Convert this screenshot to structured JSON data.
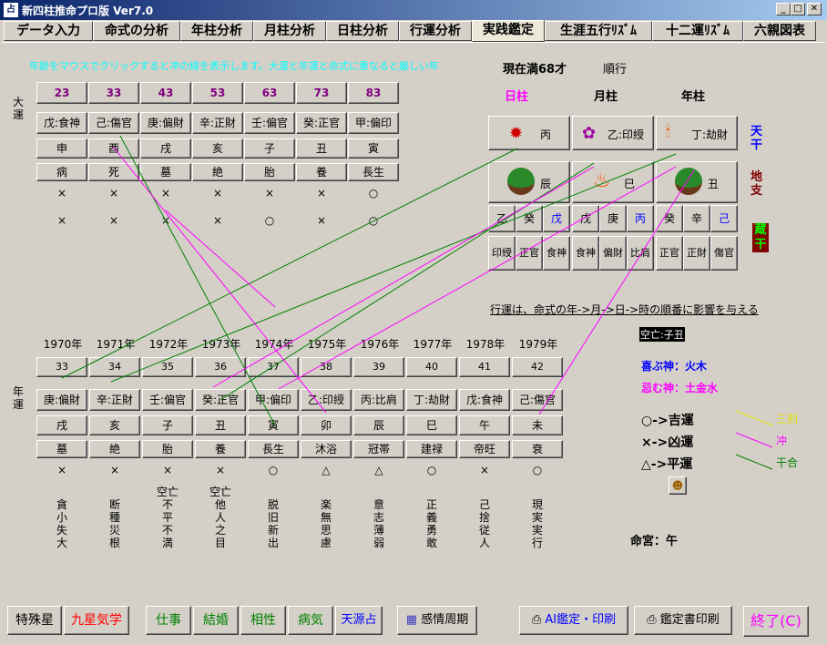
{
  "window": {
    "title": "新四柱推命プロ版 Ver7.0",
    "icon_name": "app-icon",
    "minimize_label": "_",
    "maximize_label": "□",
    "close_label": "✕"
  },
  "tabs": [
    {
      "label": "データ入力"
    },
    {
      "label": "命式の分析"
    },
    {
      "label": "年柱分析"
    },
    {
      "label": "月柱分析"
    },
    {
      "label": "日柱分析"
    },
    {
      "label": "行運分析"
    },
    {
      "label": "実践鑑定"
    },
    {
      "label": "生涯五行ﾘｽﾞﾑ"
    },
    {
      "label": "十二運ﾘｽﾞﾑ"
    },
    {
      "label": "六親図表"
    }
  ],
  "info": {
    "marquee": "年齢をマウスでクリックすると冲の線を表示します。大運と年運と命式に重なると厳しい年",
    "current_age": "現在満68才",
    "direction": "順行"
  },
  "daiun": {
    "side_label": "大運",
    "ages": [
      "23",
      "33",
      "43",
      "53",
      "63",
      "73",
      "83"
    ],
    "stems": [
      "戊:食神",
      "己:傷官",
      "庚:偏財",
      "辛:正財",
      "壬:偏官",
      "癸:正官",
      "甲:偏印"
    ],
    "branches": [
      "申",
      "酉",
      "戌",
      "亥",
      "子",
      "丑",
      "寅"
    ],
    "twelve": [
      "病",
      "死",
      "墓",
      "絶",
      "胎",
      "養",
      "長生"
    ],
    "mark1": [
      "×",
      "×",
      "×",
      "×",
      "×",
      "×",
      "○"
    ],
    "mark2": [
      "×",
      "×",
      "×",
      "×",
      "○",
      "×",
      "○"
    ]
  },
  "meishiki": {
    "col_day": "日柱",
    "col_month": "月柱",
    "col_year": "年柱",
    "stems": [
      "丙",
      "乙:印綬",
      "丁:劫財"
    ],
    "stem_icons": [
      "sun-icon",
      "flower-icon",
      "candle-icon"
    ],
    "branches": [
      "辰",
      "巳",
      "丑"
    ],
    "branch_icons": [
      "tree-icon",
      "fire-icon",
      "tree-icon"
    ],
    "hidden_stems": [
      [
        "乙",
        "癸",
        "戊"
      ],
      [
        "戊",
        "庚",
        "丙"
      ],
      [
        "癸",
        "辛",
        "己"
      ]
    ],
    "hidden_colors": [
      [
        "#000000",
        "#000000",
        "#0000ff"
      ],
      [
        "#000000",
        "#000000",
        "#0000ff"
      ],
      [
        "#000000",
        "#000000",
        "#0000ff"
      ]
    ],
    "hidden_stars": [
      [
        "印綬",
        "正官",
        "食神"
      ],
      [
        "食神",
        "偏財",
        "比肩"
      ],
      [
        "正官",
        "正財",
        "傷官"
      ]
    ],
    "side_tenkan": "天干",
    "side_chishi": "地支",
    "side_zoukan": "蔵干"
  },
  "note": {
    "flow": "行運は、命式の年->月->日->時の順番に影響を与える",
    "kubo": "空亡:子丑",
    "kishin": "喜ぶ神：火木",
    "kijin": "忌む神：土金水"
  },
  "legend": {
    "good": "○->吉運",
    "bad": "×->凶運",
    "flat": "△->平運",
    "sankei": "三刑",
    "chuu": "冲",
    "kango": "干合",
    "colors": {
      "sankei": "#e0e000",
      "chuu": "#ff00ff",
      "kango": "#008000"
    }
  },
  "nenun": {
    "side_label": "年運",
    "years": [
      "1970年",
      "1971年",
      "1972年",
      "1973年",
      "1974年",
      "1975年",
      "1976年",
      "1977年",
      "1978年",
      "1979年"
    ],
    "ages": [
      "33",
      "34",
      "35",
      "36",
      "37",
      "38",
      "39",
      "40",
      "41",
      "42"
    ],
    "stems": [
      "庚:偏財",
      "辛:正財",
      "壬:偏官",
      "癸:正官",
      "甲:偏印",
      "乙:印綬",
      "丙:比肩",
      "丁:劫財",
      "戊:食神",
      "己:傷官"
    ],
    "branches": [
      "戌",
      "亥",
      "子",
      "丑",
      "寅",
      "卯",
      "辰",
      "巳",
      "午",
      "未"
    ],
    "twelve": [
      "墓",
      "絶",
      "胎",
      "養",
      "長生",
      "沐浴",
      "冠帯",
      "建禄",
      "帝旺",
      "衰"
    ],
    "marks": [
      "×",
      "×",
      "×",
      "×",
      "○",
      "△",
      "△",
      "○",
      "×",
      "○"
    ],
    "kubo": [
      "",
      "",
      "空亡",
      "空亡",
      "",
      "",
      "",
      "",
      "",
      ""
    ],
    "keywords": [
      "貪小失大",
      "断種災根",
      "不平不満",
      "他人之目",
      "脱旧新出",
      "楽無思慮",
      "意志薄弱",
      "正義勇敢",
      "己捨従人",
      "現実実行"
    ]
  },
  "meikyu": "命宮：午",
  "bottom": {
    "tokushu": "特殊星",
    "kyusei": "九星気学",
    "shigoto": "仕事",
    "kekkon": "結婚",
    "aisho": "相性",
    "byoki": "病気",
    "tengen": "天源占",
    "kanjo": "感情周期",
    "ai": "AI鑑定・印刷",
    "print": "鑑定書印刷",
    "exit": "終了(C)"
  }
}
